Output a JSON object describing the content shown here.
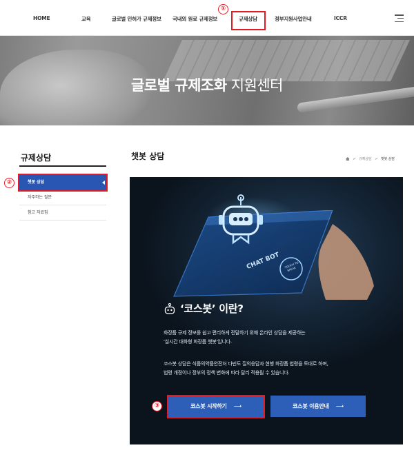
{
  "nav": {
    "items": [
      {
        "label": "HOME"
      },
      {
        "label": "교육"
      },
      {
        "label": "글로벌 인허가 규제정보"
      },
      {
        "label": "국내외 원료 규제정보"
      },
      {
        "label": "규제상담"
      },
      {
        "label": "정부지원사업안내"
      },
      {
        "label": "ICCR"
      }
    ],
    "active_index": 4
  },
  "banner": {
    "title_bold": "글로벌 규제조화",
    "title_light": " 지원센터"
  },
  "sidebar": {
    "title": "규제상담",
    "items": [
      {
        "label": "챗봇 상담",
        "active": true
      },
      {
        "label": "자주하는 질문",
        "active": false
      },
      {
        "label": "참고 자료집",
        "active": false
      }
    ]
  },
  "main": {
    "page_title": "챗봇 상담",
    "breadcrumb": [
      "규제상담",
      "챗봇 상담"
    ],
    "panel": {
      "chat_bot_text": "CHAT BOT",
      "touch_text_1": "TOUCH TO",
      "touch_text_2": "SPEAK",
      "heading": "‘코스봇’ 이란?",
      "para1_line1": "화장품 규제 정보를 쉽고 편리하게 전달하기 위해 온라인 상담을 제공하는",
      "para1_line2": "'실시간 대화형 화장품 챗봇'입니다.",
      "para2_line1": "코스봇 상담은 식품의약품안전처 다빈도 질의응답과 현행 화장품 법령을 토대로 하며,",
      "para2_line2": "법령 개정이나 정부의 정책 변화에 따라 달리 적용될 수 있습니다.",
      "start_button": "코스봇 시작하기",
      "guide_button": "코스봇 이용안내",
      "arrow": "⟶"
    }
  },
  "annotations": [
    "①",
    "②",
    "③"
  ],
  "colors": {
    "accent": "#2d5fb9",
    "active_sidebar": "#2a56b3",
    "annotation": "#e31b23",
    "panel_bg": "#0b141d"
  }
}
